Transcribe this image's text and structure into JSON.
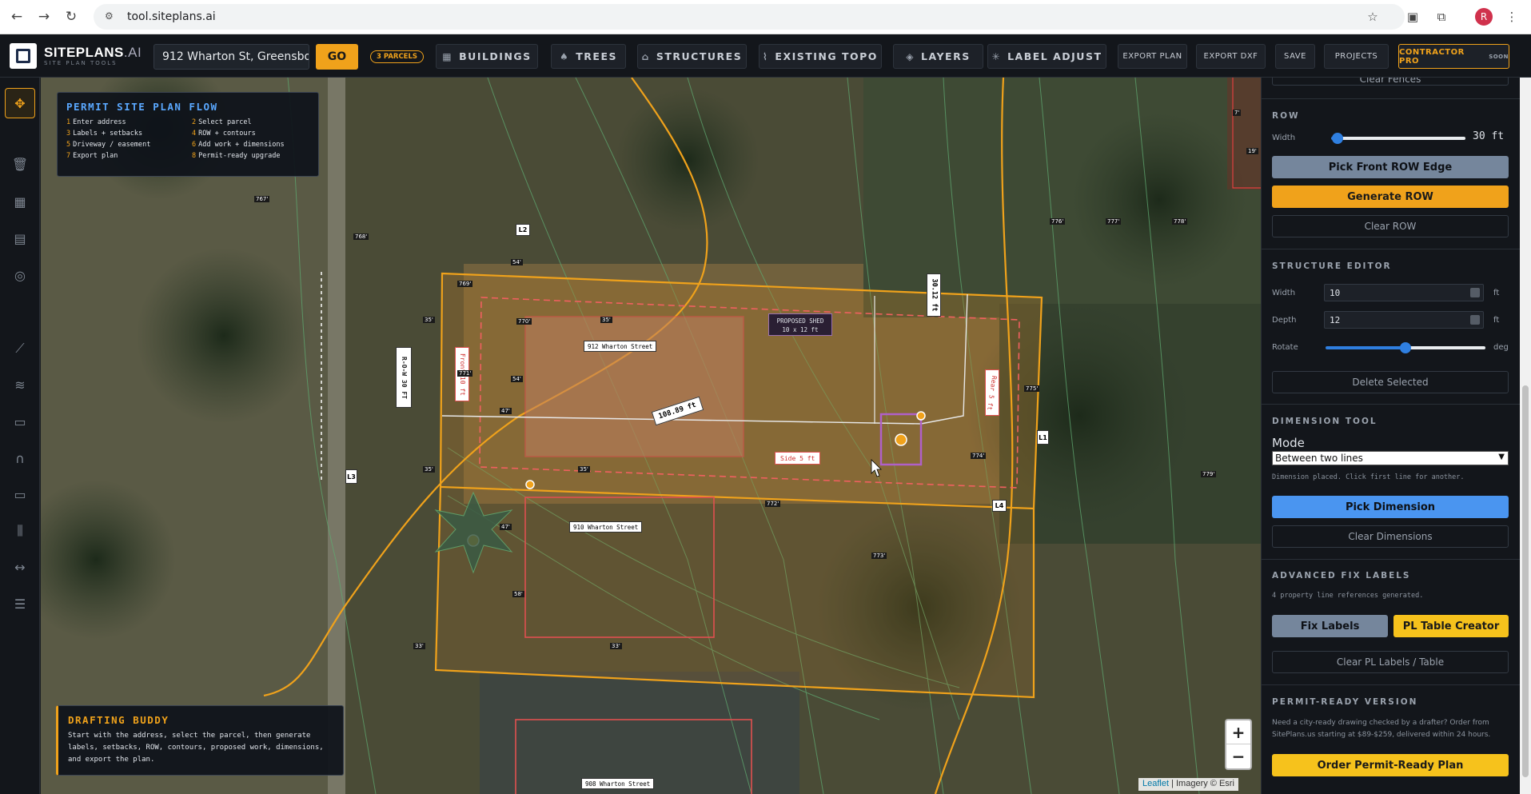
{
  "browser": {
    "url": "tool.siteplans.ai",
    "avatar_letter": "R"
  },
  "app": {
    "brand": "SITEPLANS",
    "brand_suffix": ".AI",
    "tagline": "SITE PLAN TOOLS",
    "address_value": "912 Wharton St, Greensbor",
    "go_label": "GO",
    "parcels_badge": "3 PARCELS",
    "toolbar": {
      "buildings": "BUILDINGS",
      "trees": "TREES",
      "structures": "STRUCTURES",
      "existing_topo": "EXISTING TOPO",
      "layers": "LAYERS",
      "label_adjust": "LABEL ADJUST",
      "export_plan": "EXPORT PLAN",
      "export_dxf": "EXPORT DXF",
      "save": "SAVE",
      "projects": "PROJECTS",
      "contractor_pro": "CONTRACTOR PRO",
      "soon": "SOON"
    }
  },
  "flow": {
    "title": "PERMIT SITE PLAN FLOW",
    "steps": [
      {
        "n": "1",
        "t": "Enter address"
      },
      {
        "n": "2",
        "t": "Select parcel"
      },
      {
        "n": "3",
        "t": "Labels + setbacks"
      },
      {
        "n": "4",
        "t": "ROW + contours"
      },
      {
        "n": "5",
        "t": "Driveway / easement"
      },
      {
        "n": "6",
        "t": "Add work + dimensions"
      },
      {
        "n": "7",
        "t": "Export plan"
      },
      {
        "n": "8",
        "t": "Permit-ready upgrade"
      }
    ]
  },
  "buddy": {
    "title": "DRAFTING BUDDY",
    "text": "Start with the address, select the parcel, then generate labels, setbacks, ROW, contours, proposed work, dimensions, and export the plan."
  },
  "map_labels": {
    "row_label": "R-O-W 30 FT",
    "front": "Front 10 ft",
    "rear": "Rear 5 ft",
    "side": "Side 5 ft",
    "house1": "912 Wharton Street",
    "house2": "910 Wharton Street",
    "house3": "908 Wharton Street",
    "dim_main": "108.89 ft",
    "dim_vert": "30.12 ft",
    "shed_line1": "PROPOSED SHED",
    "shed_line2": "10 x 12 ft",
    "l1": "L1",
    "l2": "L2",
    "l3": "L3",
    "l4": "L4",
    "d54a": "54'",
    "d54b": "54'",
    "d35a": "35'",
    "d35b": "35'",
    "d47a": "47'",
    "d47b": "47'",
    "d35c": "35'",
    "d35d": "35'",
    "d58": "58'",
    "d33a": "33'",
    "d33b": "33'",
    "c770": "770'",
    "c771": "771'",
    "c767": "767'",
    "c768": "768'",
    "c769": "769'",
    "c772": "772'",
    "c773": "773'",
    "c774": "774'",
    "c775": "775'",
    "c776": "776'",
    "c777": "777'",
    "c778": "778'",
    "c779": "779'",
    "c7": "7'",
    "c19": "19'"
  },
  "zoom": {
    "in": "+",
    "out": "−"
  },
  "attribution": {
    "leaflet": "Leaflet",
    "rest": " | Imagery © Esri"
  },
  "panel": {
    "clear_fences": "Clear Fences",
    "row": {
      "title": "ROW",
      "width_label": "Width",
      "width_value": "30 ft",
      "width_fraction": 0.05,
      "pick": "Pick Front ROW Edge",
      "generate": "Generate ROW",
      "clear": "Clear ROW"
    },
    "structure": {
      "title": "STRUCTURE EDITOR",
      "width_label": "Width",
      "width_value": "10",
      "width_unit": "ft",
      "depth_label": "Depth",
      "depth_value": "12",
      "depth_unit": "ft",
      "rotate_label": "Rotate",
      "rotate_unit": "deg",
      "rotate_fraction": 0.5,
      "delete": "Delete Selected"
    },
    "dimension": {
      "title": "DIMENSION TOOL",
      "mode_label": "Mode",
      "mode_value": "Between two lines",
      "note": "Dimension placed. Click first line for another.",
      "pick": "Pick Dimension",
      "clear": "Clear Dimensions"
    },
    "fix": {
      "title": "ADVANCED FIX LABELS",
      "note": "4 property line references generated.",
      "fix": "Fix Labels",
      "pl_table": "PL Table Creator",
      "clear": "Clear PL Labels / Table"
    },
    "permit": {
      "title": "PERMIT-READY VERSION",
      "text": "Need a city-ready drawing checked by a drafter? Order from SitePlans.us starting at $89-$259, delivered within 24 hours.",
      "order": "Order Permit-Ready Plan"
    }
  }
}
